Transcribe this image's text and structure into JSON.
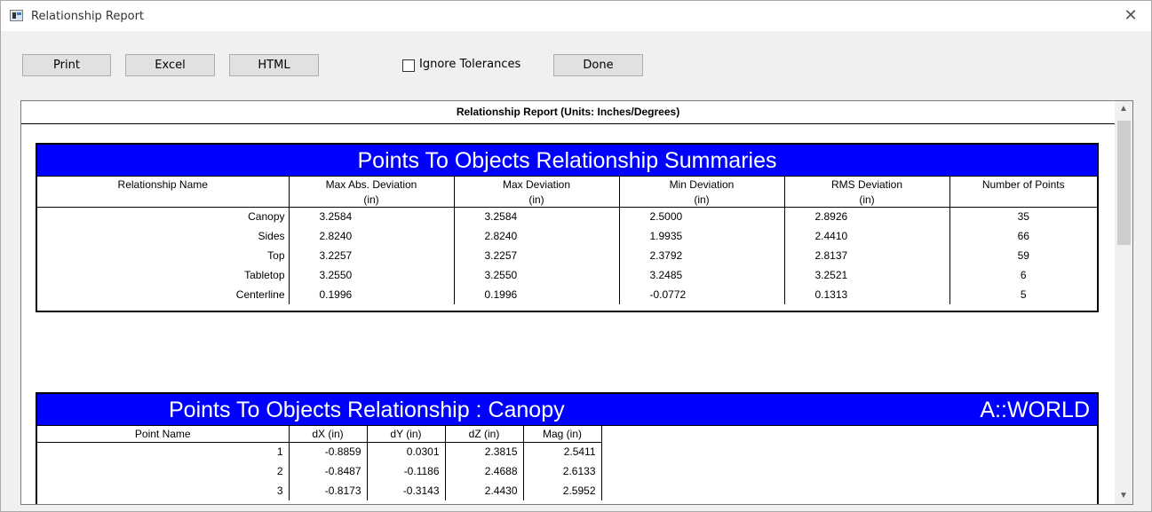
{
  "window": {
    "title": "Relationship Report",
    "close_glyph": "✕"
  },
  "toolbar": {
    "print_label": "Print",
    "excel_label": "Excel",
    "html_label": "HTML",
    "ignore_tolerances_label": "Ignore Tolerances",
    "ignore_tolerances_checked": false,
    "done_label": "Done"
  },
  "report": {
    "header": "Relationship Report (Units: Inches/Degrees)"
  },
  "summary": {
    "title": "Points To Objects Relationship Summaries",
    "columns": [
      {
        "label": "Relationship Name",
        "unit": ""
      },
      {
        "label": "Max Abs. Deviation",
        "unit": "(in)"
      },
      {
        "label": "Max Deviation",
        "unit": "(in)"
      },
      {
        "label": "Min Deviation",
        "unit": "(in)"
      },
      {
        "label": "RMS Deviation",
        "unit": "(in)"
      },
      {
        "label": "Number of Points",
        "unit": ""
      }
    ],
    "rows": [
      [
        "Canopy",
        "3.2584",
        "3.2584",
        "2.5000",
        "2.8926",
        "35"
      ],
      [
        "Sides",
        "2.8240",
        "2.8240",
        "1.9935",
        "2.4410",
        "66"
      ],
      [
        "Top",
        "3.2257",
        "3.2257",
        "2.3792",
        "2.8137",
        "59"
      ],
      [
        "Tabletop",
        "3.2550",
        "3.2550",
        "3.2485",
        "3.2521",
        "6"
      ],
      [
        "Centerline",
        "0.1996",
        "0.1996",
        "-0.0772",
        "0.1313",
        "5"
      ]
    ]
  },
  "canopy": {
    "title": "Points To Objects Relationship :  Canopy",
    "frame": "A::WORLD",
    "columns": [
      "Point Name",
      "dX (in)",
      "dY (in)",
      "dZ (in)",
      "Mag (in)"
    ],
    "rows": [
      [
        "1",
        "-0.8859",
        "0.0301",
        "2.3815",
        "2.5411"
      ],
      [
        "2",
        "-0.8487",
        "-0.1186",
        "2.4688",
        "2.6133"
      ],
      [
        "3",
        "-0.8173",
        "-0.3143",
        "2.4430",
        "2.5952"
      ]
    ]
  },
  "scrollbar": {
    "up_glyph": "▲",
    "down_glyph": "▼"
  }
}
